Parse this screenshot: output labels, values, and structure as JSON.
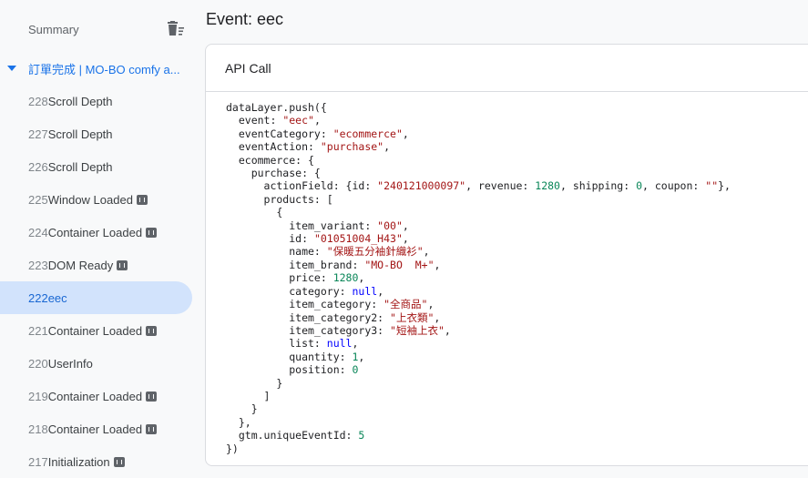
{
  "sidebar": {
    "summary_label": "Summary",
    "page_label": "訂單完成 | MO-BO comfy a...",
    "events": [
      {
        "num": "228",
        "name": "Scroll Depth",
        "code_icon": false,
        "selected": false
      },
      {
        "num": "227",
        "name": "Scroll Depth",
        "code_icon": false,
        "selected": false
      },
      {
        "num": "226",
        "name": "Scroll Depth",
        "code_icon": false,
        "selected": false
      },
      {
        "num": "225",
        "name": "Window Loaded",
        "code_icon": true,
        "selected": false
      },
      {
        "num": "224",
        "name": "Container Loaded",
        "code_icon": true,
        "selected": false
      },
      {
        "num": "223",
        "name": "DOM Ready",
        "code_icon": true,
        "selected": false
      },
      {
        "num": "222",
        "name": "eec",
        "code_icon": false,
        "selected": true
      },
      {
        "num": "221",
        "name": "Container Loaded",
        "code_icon": true,
        "selected": false
      },
      {
        "num": "220",
        "name": "UserInfo",
        "code_icon": false,
        "selected": false
      },
      {
        "num": "219",
        "name": "Container Loaded",
        "code_icon": true,
        "selected": false
      },
      {
        "num": "218",
        "name": "Container Loaded",
        "code_icon": true,
        "selected": false
      },
      {
        "num": "217",
        "name": "Initialization",
        "code_icon": true,
        "selected": false
      }
    ]
  },
  "main": {
    "title": "Event: eec",
    "card_title": "API Call",
    "code": {
      "l01": "dataLayer.push({",
      "l02_key": "  event: ",
      "l02_val": "\"eec\"",
      "l03_key": "  eventCategory: ",
      "l03_val": "\"ecommerce\"",
      "l04_key": "  eventAction: ",
      "l04_val": "\"purchase\"",
      "l05": "  ecommerce: {",
      "l06": "    purchase: {",
      "l07_a": "      actionField: {id: ",
      "l07_id": "\"240121000097\"",
      "l07_b": ", revenue: ",
      "l07_rev": "1280",
      "l07_c": ", shipping: ",
      "l07_ship": "0",
      "l07_d": ", coupon: ",
      "l07_coupon": "\"\"",
      "l07_e": "},",
      "l08": "      products: [",
      "l09": "        {",
      "l10_key": "          item_variant: ",
      "l10_val": "\"00\"",
      "l11_key": "          id: ",
      "l11_val": "\"01051004_H43\"",
      "l12_key": "          name: ",
      "l12_val": "\"保暖五分袖針織衫\"",
      "l13_key": "          item_brand: ",
      "l13_val": "\"MO-BO  M+\"",
      "l14_key": "          price: ",
      "l14_val": "1280",
      "l15_key": "          category: ",
      "l15_val": "null",
      "l16_key": "          item_category: ",
      "l16_val": "\"全商品\"",
      "l17_key": "          item_category2: ",
      "l17_val": "\"上衣類\"",
      "l18_key": "          item_category3: ",
      "l18_val": "\"短袖上衣\"",
      "l19_key": "          list: ",
      "l19_val": "null",
      "l20_key": "          quantity: ",
      "l20_val": "1",
      "l21_key": "          position: ",
      "l21_val": "0",
      "l22": "        }",
      "l23": "      ]",
      "l24": "    }",
      "l25": "  },",
      "l26_key": "  gtm.uniqueEventId: ",
      "l26_val": "5",
      "l27": "})"
    }
  },
  "colors": {
    "accent": "#1a73e8",
    "selected_bg": "#d2e3fc",
    "string": "#a31515",
    "number": "#098658",
    "keyword": "#0000ff"
  },
  "icons": {
    "summary_action": "clear-list-icon",
    "page_toggle": "caret-down-icon",
    "event_badge": "code-icon"
  }
}
